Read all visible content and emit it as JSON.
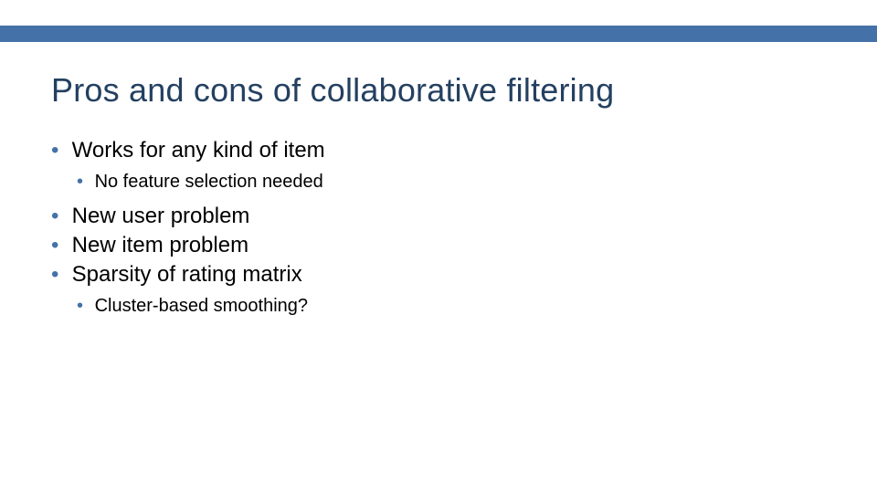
{
  "title": "Pros and cons of collaborative filtering",
  "bullets": {
    "b1": "Works for any kind of item",
    "b1a": "No feature selection needed",
    "b2": "New user problem",
    "b3": "New item problem",
    "b4": "Sparsity of rating matrix",
    "b4a": "Cluster-based smoothing?"
  }
}
